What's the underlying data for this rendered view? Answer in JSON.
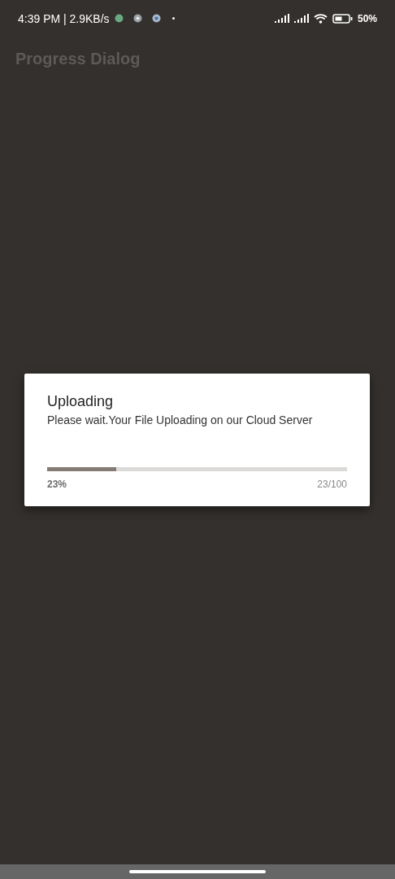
{
  "status_bar": {
    "time": "4:39 PM | 2.9KB/s",
    "battery": "50%"
  },
  "app_bar": {
    "title": "Progress Dialog"
  },
  "dialog": {
    "title": "Uploading",
    "message": "Please wait.Your File Uploading on our Cloud Server",
    "level": 0.23,
    "percent": "23%",
    "count": "23/100"
  }
}
